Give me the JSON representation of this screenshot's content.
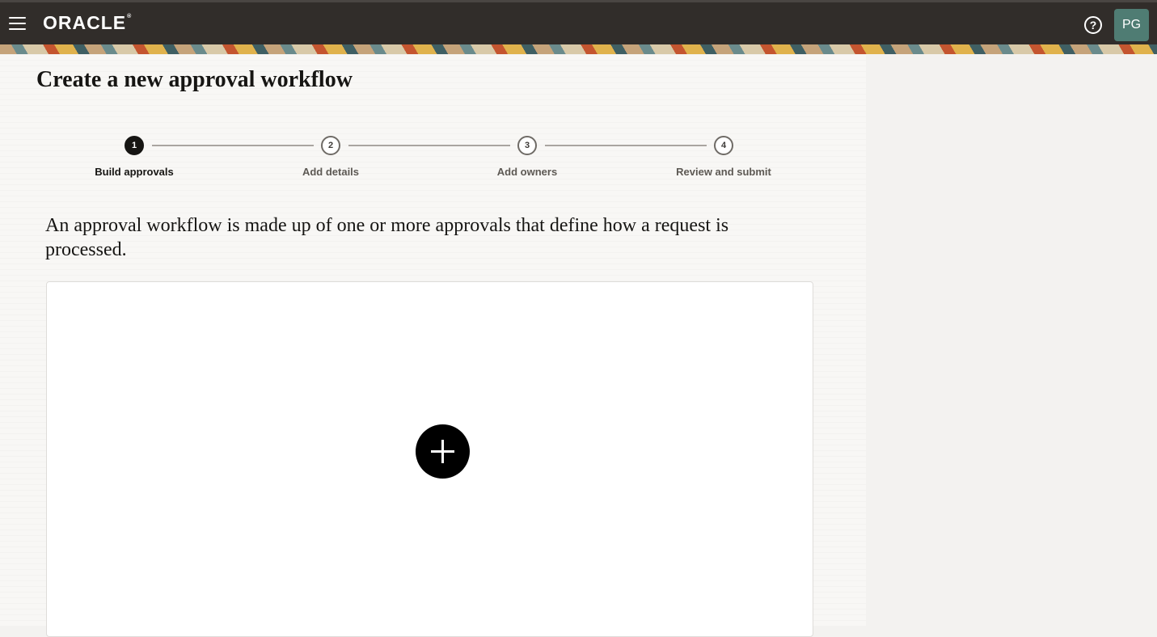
{
  "header": {
    "logo_text": "ORACLE",
    "logo_mark": "®",
    "avatar_initials": "PG",
    "help_glyph": "?"
  },
  "page": {
    "title": "Create a new approval workflow",
    "intro": "An approval workflow is made up of one or more approvals that define how a request is processed."
  },
  "train": {
    "steps": [
      {
        "number": "1",
        "label": "Build approvals",
        "state": "current"
      },
      {
        "number": "2",
        "label": "Add details",
        "state": "upcoming"
      },
      {
        "number": "3",
        "label": "Add owners",
        "state": "upcoming"
      },
      {
        "number": "4",
        "label": "Review and submit",
        "state": "upcoming"
      }
    ]
  },
  "icons": {
    "menu": "hamburger-menu-icon",
    "help": "help-icon",
    "add": "plus-icon"
  },
  "colors": {
    "header_bg": "#312d2a",
    "accent_active": "#161513",
    "avatar_bg": "#4f7c73"
  }
}
